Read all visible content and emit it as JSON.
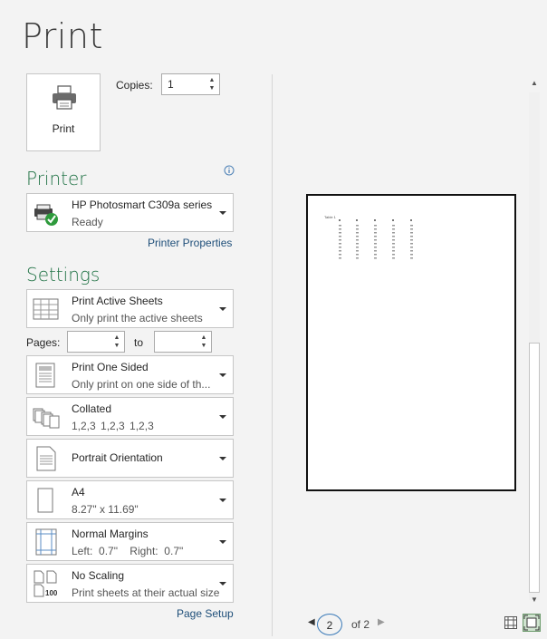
{
  "page": {
    "title": "Print"
  },
  "print_button": {
    "label": "Print",
    "icon": "printer-icon"
  },
  "copies": {
    "label": "Copies:",
    "value": "1"
  },
  "printer": {
    "heading": "Printer",
    "name": "HP Photosmart C309a series",
    "status": "Ready",
    "properties_link": "Printer Properties",
    "info_icon": "info-icon"
  },
  "settings": {
    "heading": "Settings",
    "sheets": {
      "title": "Print Active Sheets",
      "subtitle": "Only print the active sheets"
    },
    "pages": {
      "label": "Pages:",
      "to_label": "to",
      "from_value": "",
      "to_value": ""
    },
    "sides": {
      "title": "Print One Sided",
      "subtitle": "Only print on one side of th..."
    },
    "collation": {
      "title": "Collated",
      "subtitle": "1,2,3    1,2,3    1,2,3"
    },
    "orientation": {
      "title": "Portrait Orientation"
    },
    "paper": {
      "title": "A4",
      "subtitle": "8.27\" x 11.69\""
    },
    "margins": {
      "title": "Normal Margins",
      "subtitle": "Left:  0.7\"    Right:  0.7\""
    },
    "scaling": {
      "title": "No Scaling",
      "subtitle": "Print sheets at their actual size"
    },
    "page_setup_link": "Page Setup"
  },
  "preview": {
    "current_page": "2",
    "of_label": "of 2",
    "sheet_title": "Table 1"
  },
  "colors": {
    "accent": "#217346",
    "link": "#1e4e79",
    "page_bg": "#f3f3f3"
  }
}
